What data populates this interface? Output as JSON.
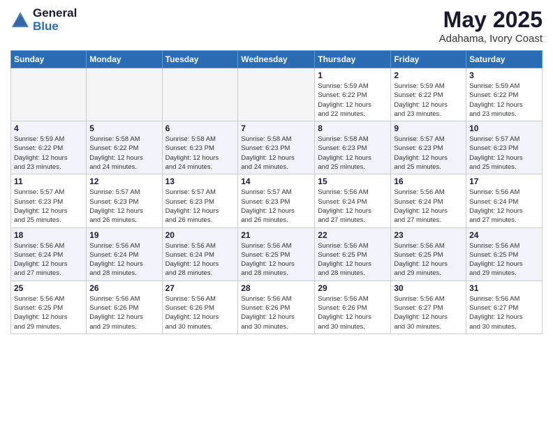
{
  "header": {
    "logo_general": "General",
    "logo_blue": "Blue",
    "title": "May 2025",
    "subtitle": "Adahama, Ivory Coast"
  },
  "calendar": {
    "days_of_week": [
      "Sunday",
      "Monday",
      "Tuesday",
      "Wednesday",
      "Thursday",
      "Friday",
      "Saturday"
    ],
    "weeks": [
      {
        "days": [
          {
            "number": "",
            "info": "",
            "empty": true
          },
          {
            "number": "",
            "info": "",
            "empty": true
          },
          {
            "number": "",
            "info": "",
            "empty": true
          },
          {
            "number": "",
            "info": "",
            "empty": true
          },
          {
            "number": "1",
            "info": "Sunrise: 5:59 AM\nSunset: 6:22 PM\nDaylight: 12 hours\nand 22 minutes.",
            "empty": false
          },
          {
            "number": "2",
            "info": "Sunrise: 5:59 AM\nSunset: 6:22 PM\nDaylight: 12 hours\nand 23 minutes.",
            "empty": false
          },
          {
            "number": "3",
            "info": "Sunrise: 5:59 AM\nSunset: 6:22 PM\nDaylight: 12 hours\nand 23 minutes.",
            "empty": false
          }
        ]
      },
      {
        "days": [
          {
            "number": "4",
            "info": "Sunrise: 5:59 AM\nSunset: 6:22 PM\nDaylight: 12 hours\nand 23 minutes.",
            "empty": false
          },
          {
            "number": "5",
            "info": "Sunrise: 5:58 AM\nSunset: 6:22 PM\nDaylight: 12 hours\nand 24 minutes.",
            "empty": false
          },
          {
            "number": "6",
            "info": "Sunrise: 5:58 AM\nSunset: 6:23 PM\nDaylight: 12 hours\nand 24 minutes.",
            "empty": false
          },
          {
            "number": "7",
            "info": "Sunrise: 5:58 AM\nSunset: 6:23 PM\nDaylight: 12 hours\nand 24 minutes.",
            "empty": false
          },
          {
            "number": "8",
            "info": "Sunrise: 5:58 AM\nSunset: 6:23 PM\nDaylight: 12 hours\nand 25 minutes.",
            "empty": false
          },
          {
            "number": "9",
            "info": "Sunrise: 5:57 AM\nSunset: 6:23 PM\nDaylight: 12 hours\nand 25 minutes.",
            "empty": false
          },
          {
            "number": "10",
            "info": "Sunrise: 5:57 AM\nSunset: 6:23 PM\nDaylight: 12 hours\nand 25 minutes.",
            "empty": false
          }
        ]
      },
      {
        "days": [
          {
            "number": "11",
            "info": "Sunrise: 5:57 AM\nSunset: 6:23 PM\nDaylight: 12 hours\nand 25 minutes.",
            "empty": false
          },
          {
            "number": "12",
            "info": "Sunrise: 5:57 AM\nSunset: 6:23 PM\nDaylight: 12 hours\nand 26 minutes.",
            "empty": false
          },
          {
            "number": "13",
            "info": "Sunrise: 5:57 AM\nSunset: 6:23 PM\nDaylight: 12 hours\nand 26 minutes.",
            "empty": false
          },
          {
            "number": "14",
            "info": "Sunrise: 5:57 AM\nSunset: 6:23 PM\nDaylight: 12 hours\nand 26 minutes.",
            "empty": false
          },
          {
            "number": "15",
            "info": "Sunrise: 5:56 AM\nSunset: 6:24 PM\nDaylight: 12 hours\nand 27 minutes.",
            "empty": false
          },
          {
            "number": "16",
            "info": "Sunrise: 5:56 AM\nSunset: 6:24 PM\nDaylight: 12 hours\nand 27 minutes.",
            "empty": false
          },
          {
            "number": "17",
            "info": "Sunrise: 5:56 AM\nSunset: 6:24 PM\nDaylight: 12 hours\nand 27 minutes.",
            "empty": false
          }
        ]
      },
      {
        "days": [
          {
            "number": "18",
            "info": "Sunrise: 5:56 AM\nSunset: 6:24 PM\nDaylight: 12 hours\nand 27 minutes.",
            "empty": false
          },
          {
            "number": "19",
            "info": "Sunrise: 5:56 AM\nSunset: 6:24 PM\nDaylight: 12 hours\nand 28 minutes.",
            "empty": false
          },
          {
            "number": "20",
            "info": "Sunrise: 5:56 AM\nSunset: 6:24 PM\nDaylight: 12 hours\nand 28 minutes.",
            "empty": false
          },
          {
            "number": "21",
            "info": "Sunrise: 5:56 AM\nSunset: 6:25 PM\nDaylight: 12 hours\nand 28 minutes.",
            "empty": false
          },
          {
            "number": "22",
            "info": "Sunrise: 5:56 AM\nSunset: 6:25 PM\nDaylight: 12 hours\nand 28 minutes.",
            "empty": false
          },
          {
            "number": "23",
            "info": "Sunrise: 5:56 AM\nSunset: 6:25 PM\nDaylight: 12 hours\nand 29 minutes.",
            "empty": false
          },
          {
            "number": "24",
            "info": "Sunrise: 5:56 AM\nSunset: 6:25 PM\nDaylight: 12 hours\nand 29 minutes.",
            "empty": false
          }
        ]
      },
      {
        "days": [
          {
            "number": "25",
            "info": "Sunrise: 5:56 AM\nSunset: 6:25 PM\nDaylight: 12 hours\nand 29 minutes.",
            "empty": false
          },
          {
            "number": "26",
            "info": "Sunrise: 5:56 AM\nSunset: 6:26 PM\nDaylight: 12 hours\nand 29 minutes.",
            "empty": false
          },
          {
            "number": "27",
            "info": "Sunrise: 5:56 AM\nSunset: 6:26 PM\nDaylight: 12 hours\nand 30 minutes.",
            "empty": false
          },
          {
            "number": "28",
            "info": "Sunrise: 5:56 AM\nSunset: 6:26 PM\nDaylight: 12 hours\nand 30 minutes.",
            "empty": false
          },
          {
            "number": "29",
            "info": "Sunrise: 5:56 AM\nSunset: 6:26 PM\nDaylight: 12 hours\nand 30 minutes.",
            "empty": false
          },
          {
            "number": "30",
            "info": "Sunrise: 5:56 AM\nSunset: 6:27 PM\nDaylight: 12 hours\nand 30 minutes.",
            "empty": false
          },
          {
            "number": "31",
            "info": "Sunrise: 5:56 AM\nSunset: 6:27 PM\nDaylight: 12 hours\nand 30 minutes.",
            "empty": false
          }
        ]
      }
    ]
  }
}
